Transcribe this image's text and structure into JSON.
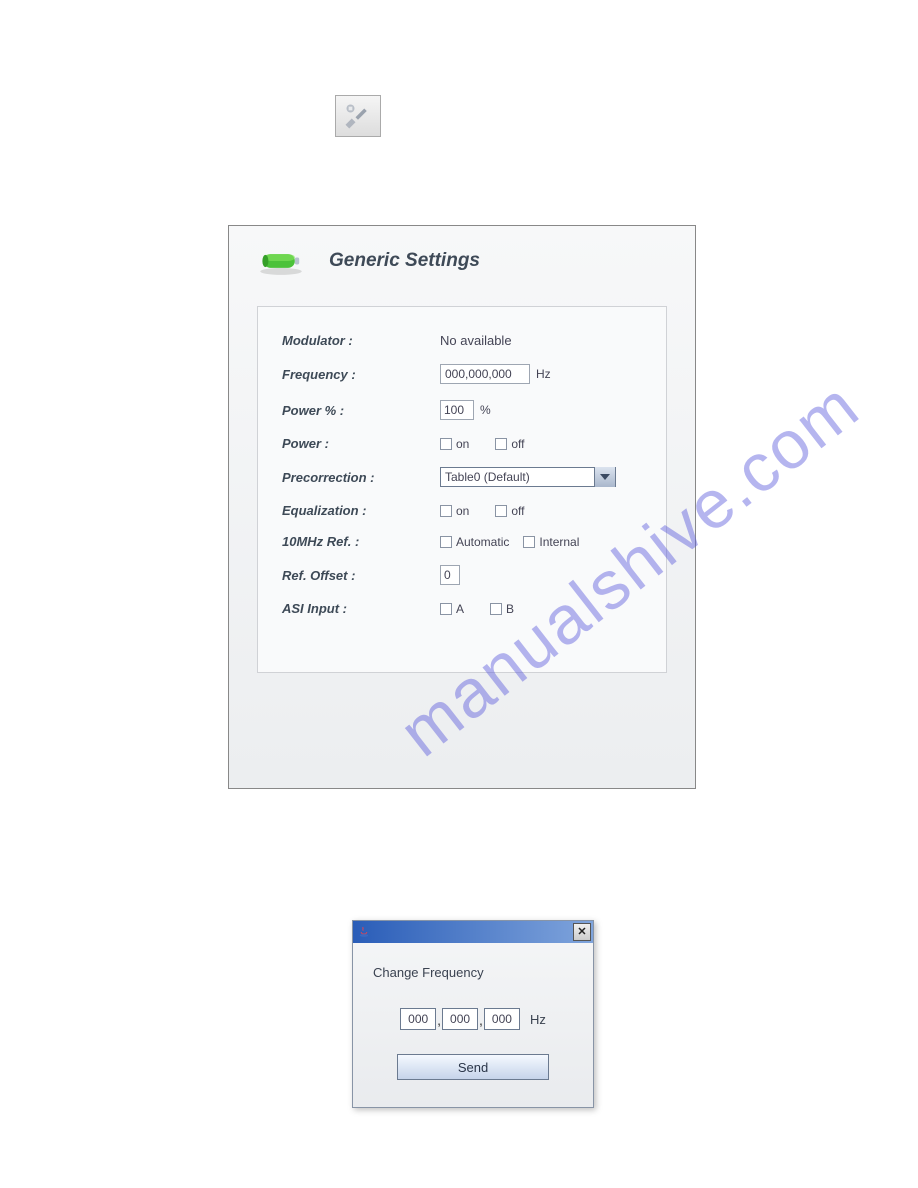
{
  "toolsIcon": "tools-icon",
  "panel": {
    "title": "Generic Settings",
    "rows": {
      "modulator": {
        "label": "Modulator :",
        "value": "No available"
      },
      "frequency": {
        "label": "Frequency :",
        "value": "000,000,000",
        "unit": "Hz"
      },
      "powerPct": {
        "label": "Power % :",
        "value": "100",
        "unit": "%"
      },
      "power": {
        "label": "Power :",
        "opt1": "on",
        "opt2": "off"
      },
      "precorrection": {
        "label": "Precorrection :",
        "selected": "Table0 (Default)"
      },
      "equalization": {
        "label": "Equalization :",
        "opt1": "on",
        "opt2": "off"
      },
      "tenMhz": {
        "label": "10MHz Ref. :",
        "opt1": "Automatic",
        "opt2": "Internal"
      },
      "refOffset": {
        "label": "Ref. Offset :",
        "value": "0"
      },
      "asiInput": {
        "label": "ASI Input :",
        "opt1": "A",
        "opt2": "B"
      }
    }
  },
  "dialog": {
    "title": "Change Frequency",
    "f1": "000",
    "f2": "000",
    "f3": "000",
    "unit": "Hz",
    "button": "Send"
  },
  "watermark": "manualshive.com"
}
